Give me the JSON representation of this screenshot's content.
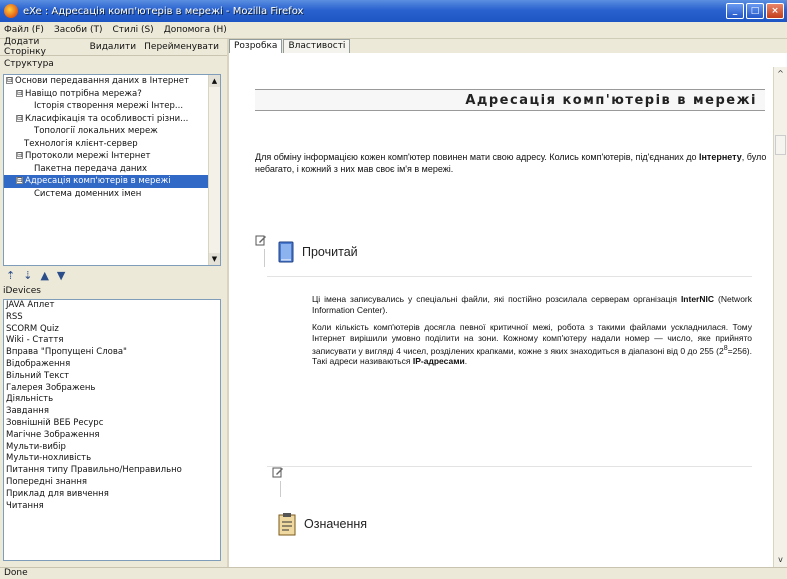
{
  "window": {
    "title": "eXe : Адресація комп'ютерів в мережі - Mozilla Firefox",
    "controls": [
      "_",
      "□",
      "×"
    ]
  },
  "menu": [
    "Файл (F)",
    "Засоби (T)",
    "Стилі (S)",
    "Допомога (H)"
  ],
  "toolbar": [
    "Додати Сторінку",
    "Видалити",
    "Перейменувати"
  ],
  "structure": {
    "title": "Структура",
    "items": [
      {
        "label": "Основи передавання даних в Інтернет",
        "toggle": "⊟"
      },
      {
        "label": "Навіщо потрібна мережа?",
        "toggle": "⊟"
      },
      {
        "label": "Історія створення мережі Інтер...",
        "toggle": ""
      },
      {
        "label": "Класифікація та особливості різни...",
        "toggle": "⊟"
      },
      {
        "label": "Топології локальних мереж",
        "toggle": ""
      },
      {
        "label": "Технологія клієнт-сервер",
        "toggle": ""
      },
      {
        "label": "Протоколи мережі Інтернет",
        "toggle": "⊟"
      },
      {
        "label": "Пакетна передача даних",
        "toggle": ""
      },
      {
        "label": "Адресація комп'ютерів в мережі",
        "toggle": "⊟"
      },
      {
        "label": "Система доменних імен",
        "toggle": ""
      }
    ]
  },
  "nav_arrows": [
    "⇡",
    "⇣",
    "▲",
    "▼"
  ],
  "idevices": {
    "title": "iDevices",
    "items": [
      "JAVA Аплет",
      "RSS",
      "SCORM Quiz",
      "Wiki - Стаття",
      "Вправа \"Пропущені Слова\"",
      "Відображення",
      "Вільний Текст",
      "Галерея Зображень",
      "Діяльність",
      "Завдання",
      "Зовнішній ВЕБ Ресурс",
      "Магічне Зображення",
      "Мульти-вибір",
      "Мульти-нохливість",
      "Питання типу Правильно/Неправильно",
      "Попередні знання",
      "Приклад для вивчення",
      "Читання"
    ]
  },
  "tabs": [
    "Розробка",
    "Властивості"
  ],
  "content": {
    "page_title": "Адресація комп'ютерів в мережі",
    "intro_before": "Для обміну інформацією кожен комп'ютер повинен мати свою адресу. Колись комп'ютерів, під'єднаних до ",
    "intro_bold": "Інтернету",
    "intro_after": ", було небагато, і кожний з них мав своє ім'я в мережі.",
    "read_label": "Прочитай",
    "read_p1_before": "Ці імена записувались у спеціальні файли, які постійно розсилала серверам організація ",
    "read_p1_bold": "InterNIC",
    "read_p1_after": " (Network Information Center).",
    "read_p2_before": "Коли кількість комп'ютерів досягла певної критичної межі, робота з такими файлами ускладнилася. Тому Інтернет вирішили умовно поділити на зони. Кожному комп'ютеру надали номер — число, яке прийнято записувати у вигляді 4 чисел, розділених крапками, кожне з яких знаходиться в діапазоні від 0 до 255 (2",
    "read_p2_sup": "8",
    "read_p2_mid": "=256). Такі адреси називаються ",
    "read_p2_bold": "IP-адресами",
    "read_p2_end": ".",
    "def_label": "Означення"
  },
  "status": "Done"
}
